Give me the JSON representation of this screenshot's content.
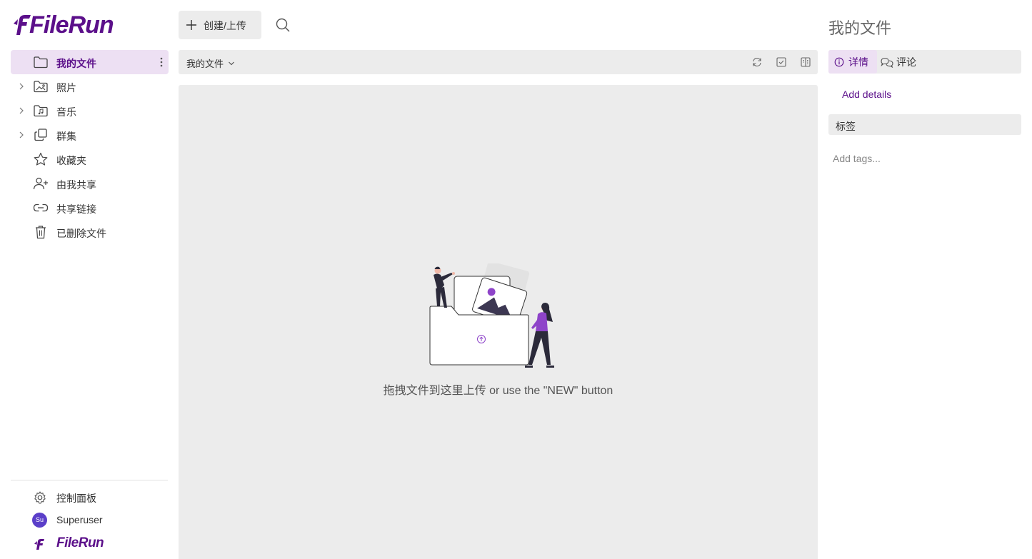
{
  "brand": {
    "name": "FileRun",
    "color": "#5b0f8a"
  },
  "sidebar": {
    "items": [
      {
        "label": "我的文件",
        "icon": "folder-icon",
        "active": true
      },
      {
        "label": "照片",
        "icon": "photos-folder-icon"
      },
      {
        "label": "音乐",
        "icon": "music-folder-icon"
      },
      {
        "label": "群集",
        "icon": "collections-icon"
      },
      {
        "label": "收藏夹",
        "icon": "star-icon"
      },
      {
        "label": "由我共享",
        "icon": "share-user-icon"
      },
      {
        "label": "共享链接",
        "icon": "link-icon"
      },
      {
        "label": "已删除文件",
        "icon": "trash-icon"
      }
    ],
    "bottom": {
      "control_panel": "控制面板",
      "user": "Superuser",
      "avatar_initials": "Su"
    }
  },
  "toolbar": {
    "create_label": "创建/上传"
  },
  "breadcrumb": {
    "current": "我的文件"
  },
  "dropzone": {
    "text": "拖拽文件到这里上传 or use the \"NEW\" button"
  },
  "details_panel": {
    "title": "我的文件",
    "tabs": [
      {
        "label": "详情",
        "icon": "info-icon",
        "active": true
      },
      {
        "label": "评论",
        "icon": "comments-icon"
      }
    ],
    "add_details": "Add details",
    "tags_header": "标签",
    "tags_placeholder": "Add tags..."
  }
}
